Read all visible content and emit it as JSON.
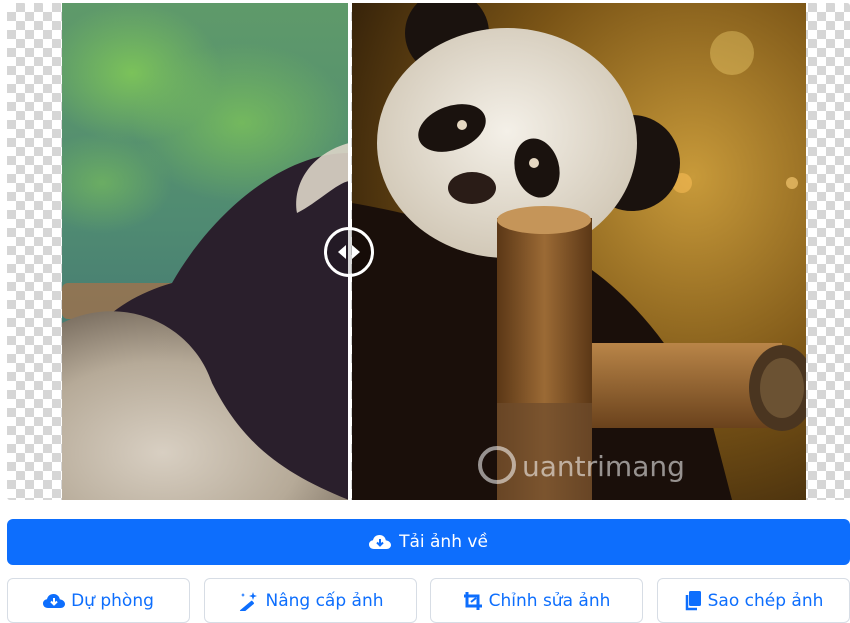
{
  "viewer": {
    "watermark": "uantrimang"
  },
  "buttons": {
    "download": {
      "label": "Tải ảnh về",
      "icon": "cloud-download-icon"
    },
    "backup": {
      "label": "Dự phòng",
      "icon": "cloud-download-icon"
    },
    "enhance": {
      "label": "Nâng cấp ảnh",
      "icon": "magic-wand-icon"
    },
    "edit": {
      "label": "Chỉnh sửa ảnh",
      "icon": "crop-icon"
    },
    "copy": {
      "label": "Sao chép ảnh",
      "icon": "copy-icon"
    }
  },
  "colors": {
    "primary": "#0d6efd",
    "button_border": "#d7dde5"
  }
}
